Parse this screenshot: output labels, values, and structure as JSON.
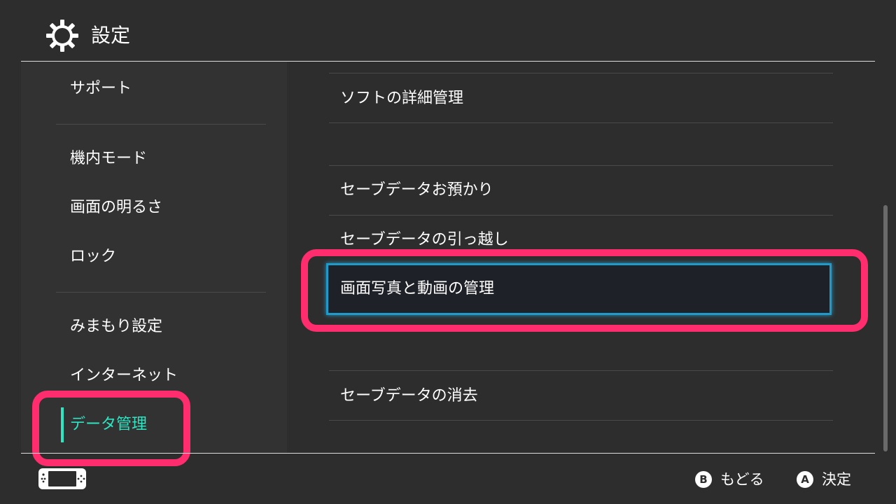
{
  "header": {
    "title": "設定",
    "icon": "gear-icon"
  },
  "sidebar": {
    "items": [
      {
        "label": "サポート"
      },
      {
        "label": "機内モード"
      },
      {
        "label": "画面の明るさ"
      },
      {
        "label": "ロック"
      },
      {
        "label": "みまもり設定"
      },
      {
        "label": "インターネット"
      },
      {
        "label": "データ管理",
        "active": true
      }
    ]
  },
  "main": {
    "items": [
      {
        "label": "ソフトの詳細管理"
      },
      {
        "label": "セーブデータお預かり"
      },
      {
        "label": "セーブデータの引っ越し"
      },
      {
        "label": "画面写真と動画の管理",
        "selected": true
      },
      {
        "label": "セーブデータの消去"
      }
    ]
  },
  "footer": {
    "back": {
      "button": "B",
      "label": "もどる"
    },
    "confirm": {
      "button": "A",
      "label": "決定"
    }
  },
  "colors": {
    "active_accent": "#2ee5c3",
    "selection_border": "#1f9ac9",
    "annotation_highlight": "#ff2d6e"
  }
}
